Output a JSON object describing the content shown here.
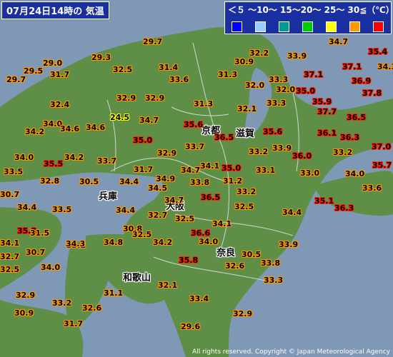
{
  "title": "07月24日14時の 気温",
  "legend": {
    "scale_text": "＜５ 〜10〜 15〜20〜 25〜 30≦（℃）",
    "colors": [
      "#0000ff",
      "#99ccff",
      "#009999",
      "#00cc00",
      "#ffff00",
      "#ff9900",
      "#ff0000"
    ]
  },
  "prefectures": [
    "京都",
    "滋賀",
    "兵庫",
    "大阪",
    "奈良",
    "和歌山"
  ],
  "temperatures": [
    "29.7",
    "29.3",
    "29.0",
    "29.5",
    "31.7",
    "29.7",
    "32.5",
    "31.4",
    "30.9",
    "32.2",
    "33.9",
    "34.7",
    "35.4",
    "33.6",
    "31.3",
    "33.3",
    "37.1",
    "37.1",
    "34.3",
    "32.0",
    "32.0",
    "35.0",
    "36.9",
    "32.9",
    "32.9",
    "31.3",
    "33.3",
    "35.9",
    "37.8",
    "32.4",
    "32.1",
    "37.7",
    "34.0",
    "24.5",
    "34.7",
    "35.6",
    "36.5",
    "34.2",
    "34.6",
    "34.6",
    "36.5",
    "35.6",
    "36.1",
    "36.3",
    "37.0",
    "35.0",
    "33.7",
    "33.2",
    "33.9",
    "33.2",
    "34.0",
    "35.5",
    "34.2",
    "33.7",
    "32.9",
    "36.0",
    "35.7",
    "33.0",
    "31.7",
    "34.7",
    "35.0",
    "34.1",
    "33.1",
    "34.0",
    "33.5",
    "32.8",
    "30.5",
    "34.4",
    "34.9",
    "33.8",
    "31.2",
    "33.2",
    "33.6",
    "30.7",
    "34.5",
    "36.5",
    "35.1",
    "34.7",
    "34.4",
    "33.5",
    "34.4",
    "32.5",
    "34.4",
    "36.3",
    "32.7",
    "32.5",
    "34.1",
    "35.3",
    "31.5",
    "30.8",
    "32.5",
    "34.8",
    "34.2",
    "36.6",
    "34.1",
    "33.2",
    "30.7",
    "34.0",
    "32.7",
    "30.5",
    "33.9",
    "34.3",
    "32.5",
    "34.0",
    "35.8",
    "32.6",
    "33.8",
    "32.1",
    "33.3",
    "31.1",
    "32.9",
    "33.2",
    "32.6",
    "33.4",
    "30.9",
    "32.9",
    "31.7",
    "29.6"
  ],
  "copyright": "All rights reserved. Copyright © Japan Meteorological Agency"
}
